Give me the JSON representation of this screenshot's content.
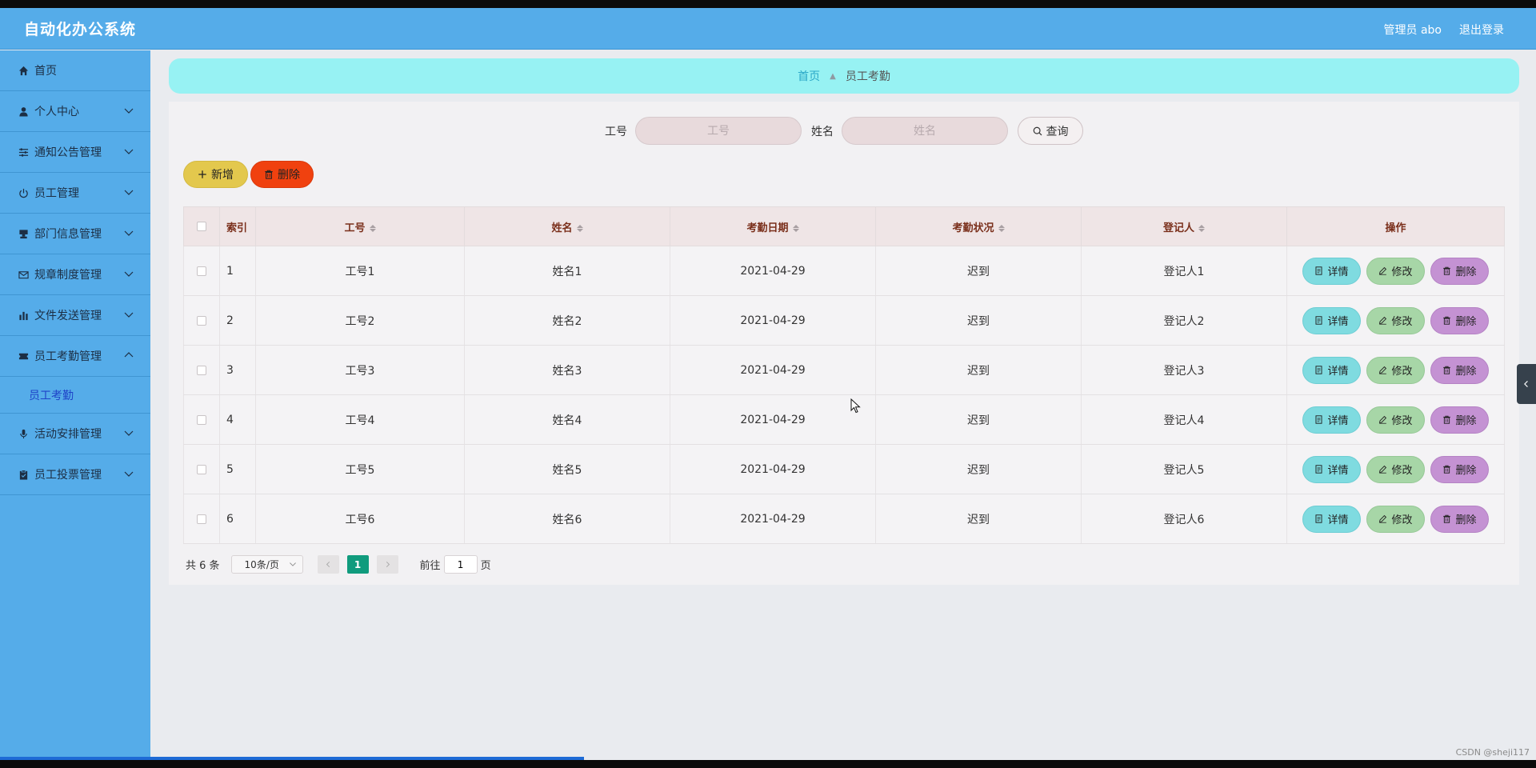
{
  "app": {
    "title": "自动化办公系统"
  },
  "header": {
    "user": "管理员 abo",
    "logout": "退出登录"
  },
  "sidebar": {
    "items": [
      {
        "label": "首页",
        "icon": "home-icon"
      },
      {
        "label": "个人中心",
        "icon": "user-icon"
      },
      {
        "label": "通知公告管理",
        "icon": "sliders-icon"
      },
      {
        "label": "员工管理",
        "icon": "power-icon"
      },
      {
        "label": "部门信息管理",
        "icon": "stamp-icon"
      },
      {
        "label": "规章制度管理",
        "icon": "mail-icon"
      },
      {
        "label": "文件发送管理",
        "icon": "bar-chart-icon"
      },
      {
        "label": "员工考勤管理",
        "icon": "ticket-icon"
      },
      {
        "label": "活动安排管理",
        "icon": "microphone-icon"
      },
      {
        "label": "员工投票管理",
        "icon": "clipboard-icon"
      }
    ],
    "submenu": {
      "label": "员工考勤"
    }
  },
  "breadcrumb": {
    "home": "首页",
    "current": "员工考勤"
  },
  "search": {
    "field1_label": "工号",
    "field1_placeholder": "工号",
    "field2_label": "姓名",
    "field2_placeholder": "姓名",
    "query_label": "查询"
  },
  "actions": {
    "add_label": "新增",
    "delete_label": "删除"
  },
  "table": {
    "headers": [
      "索引",
      "工号",
      "姓名",
      "考勤日期",
      "考勤状况",
      "登记人",
      "操作"
    ],
    "rows": [
      {
        "index": "1",
        "emp_no": "工号1",
        "name": "姓名1",
        "date": "2021-04-29",
        "status": "迟到",
        "registrar": "登记人1"
      },
      {
        "index": "2",
        "emp_no": "工号2",
        "name": "姓名2",
        "date": "2021-04-29",
        "status": "迟到",
        "registrar": "登记人2"
      },
      {
        "index": "3",
        "emp_no": "工号3",
        "name": "姓名3",
        "date": "2021-04-29",
        "status": "迟到",
        "registrar": "登记人3"
      },
      {
        "index": "4",
        "emp_no": "工号4",
        "name": "姓名4",
        "date": "2021-04-29",
        "status": "迟到",
        "registrar": "登记人4"
      },
      {
        "index": "5",
        "emp_no": "工号5",
        "name": "姓名5",
        "date": "2021-04-29",
        "status": "迟到",
        "registrar": "登记人5"
      },
      {
        "index": "6",
        "emp_no": "工号6",
        "name": "姓名6",
        "date": "2021-04-29",
        "status": "迟到",
        "registrar": "登记人6"
      }
    ],
    "row_actions": {
      "detail": "详情",
      "edit": "修改",
      "delete": "删除"
    }
  },
  "pagination": {
    "total": "共 6 条",
    "page_size": "10条/页",
    "current_page": "1",
    "goto_prefix": "前往",
    "goto_value": "1",
    "goto_suffix": "页"
  },
  "watermark": "CSDN @sheji117",
  "colors": {
    "topbar": "#55ace9",
    "breadcrumb_bg": "#97f2f3",
    "add_button": "#e3c84d",
    "delete_button": "#f0410f",
    "detail_button": "#7fdbe0",
    "edit_button": "#a7d6a7",
    "row_delete_button": "#c492d3",
    "active_page": "#109b7d"
  }
}
